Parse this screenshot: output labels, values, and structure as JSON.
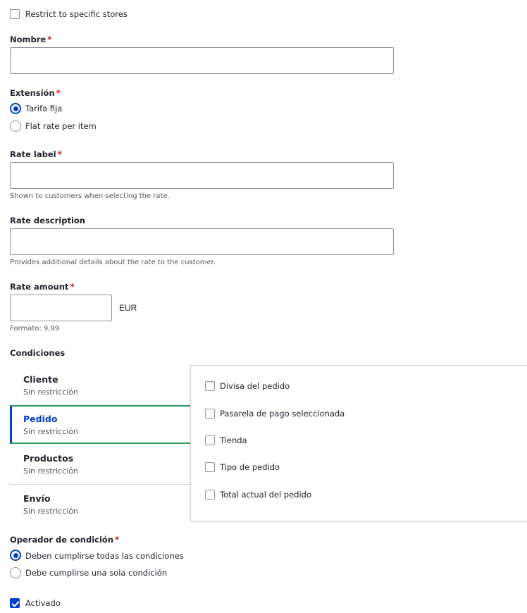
{
  "restrict_stores": {
    "label": "Restrict to specific stores",
    "checked": false
  },
  "nombre": {
    "label": "Nombre",
    "required": "*",
    "value": ""
  },
  "extension": {
    "label": "Extensión",
    "required": "*",
    "options": [
      {
        "label": "Tarifa fija",
        "checked": true
      },
      {
        "label": "Flat rate per item",
        "checked": false
      }
    ]
  },
  "rate_label": {
    "label": "Rate label",
    "required": "*",
    "value": "",
    "description": "Shown to customers when selecting the rate."
  },
  "rate_description": {
    "label": "Rate description",
    "value": "",
    "description": "Provides additional details about the rate to the customer."
  },
  "rate_amount": {
    "label": "Rate amount",
    "required": "*",
    "value": "",
    "currency": "EUR",
    "description": "Formato: 9,99"
  },
  "conditions": {
    "label": "Condiciones",
    "tabs": [
      {
        "title": "Cliente",
        "subtitle": "Sin restricción",
        "active": false
      },
      {
        "title": "Pedido",
        "subtitle": "Sin restricción",
        "active": true
      },
      {
        "title": "Productos",
        "subtitle": "Sin restricción",
        "active": false
      },
      {
        "title": "Envío",
        "subtitle": "Sin restricción",
        "active": false
      }
    ],
    "panel_options": [
      {
        "label": "Divisa del pedido",
        "checked": false
      },
      {
        "label": "Pasarela de pago seleccionada",
        "checked": false
      },
      {
        "label": "Tienda",
        "checked": false
      },
      {
        "label": "Tipo de pedido",
        "checked": false
      },
      {
        "label": "Total actual del pedido",
        "checked": false
      }
    ]
  },
  "condition_operator": {
    "label": "Operador de condición",
    "required": "*",
    "options": [
      {
        "label": "Deben cumplirse todas las condiciones",
        "checked": true
      },
      {
        "label": "Debe cumplirse una sola condición",
        "checked": false
      }
    ]
  },
  "activado": {
    "label": "Activado",
    "checked": true
  },
  "colors": {
    "accent": "#003ecc",
    "active_border": "#2f9c5a",
    "required": "#d72222"
  }
}
